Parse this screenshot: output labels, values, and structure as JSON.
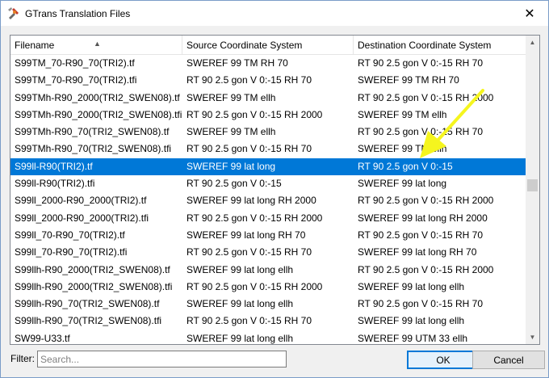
{
  "window": {
    "title": "GTrans Translation Files",
    "close_glyph": "✕"
  },
  "table": {
    "columns": [
      "Filename",
      "Source Coordinate System",
      "Destination Coordinate System"
    ],
    "sorted_column": "Filename",
    "selected_row": 7,
    "rows": [
      [
        "S99TM_70-R90_70(TRI2).tf",
        "SWEREF 99 TM RH 70",
        "RT 90 2.5 gon V 0:-15 RH 70"
      ],
      [
        "S99TM_70-R90_70(TRI2).tfi",
        "RT 90 2.5 gon V 0:-15 RH 70",
        "SWEREF 99 TM RH 70"
      ],
      [
        "S99TMh-R90_2000(TRI2_SWEN08).tf",
        "SWEREF 99 TM ellh",
        "RT 90 2.5 gon V 0:-15 RH 2000"
      ],
      [
        "S99TMh-R90_2000(TRI2_SWEN08).tfi",
        "RT 90 2.5 gon V 0:-15 RH 2000",
        "SWEREF 99 TM ellh"
      ],
      [
        "S99TMh-R90_70(TRI2_SWEN08).tf",
        "SWEREF 99 TM ellh",
        "RT 90 2.5 gon V 0:-15 RH 70"
      ],
      [
        "S99TMh-R90_70(TRI2_SWEN08).tfi",
        "RT 90 2.5 gon V 0:-15 RH 70",
        "SWEREF 99 TM ellh"
      ],
      [
        "S99ll-R90(TRI2).tf",
        "SWEREF 99 lat long",
        "RT 90 2.5 gon V 0:-15"
      ],
      [
        "S99ll-R90(TRI2).tfi",
        "RT 90 2.5 gon V 0:-15",
        "SWEREF 99 lat long"
      ],
      [
        "S99ll_2000-R90_2000(TRI2).tf",
        "SWEREF 99 lat long RH 2000",
        "RT 90 2.5 gon V 0:-15 RH 2000"
      ],
      [
        "S99ll_2000-R90_2000(TRI2).tfi",
        "RT 90 2.5 gon V 0:-15 RH 2000",
        "SWEREF 99 lat long RH 2000"
      ],
      [
        "S99ll_70-R90_70(TRI2).tf",
        "SWEREF 99 lat long RH 70",
        "RT 90 2.5 gon V 0:-15 RH 70"
      ],
      [
        "S99ll_70-R90_70(TRI2).tfi",
        "RT 90 2.5 gon V 0:-15 RH 70",
        "SWEREF 99 lat long RH 70"
      ],
      [
        "S99llh-R90_2000(TRI2_SWEN08).tf",
        "SWEREF 99 lat long ellh",
        "RT 90 2.5 gon V 0:-15 RH 2000"
      ],
      [
        "S99llh-R90_2000(TRI2_SWEN08).tfi",
        "RT 90 2.5 gon V 0:-15 RH 2000",
        "SWEREF 99 lat long ellh"
      ],
      [
        "S99llh-R90_70(TRI2_SWEN08).tf",
        "SWEREF 99 lat long ellh",
        "RT 90 2.5 gon V 0:-15 RH 70"
      ],
      [
        "S99llh-R90_70(TRI2_SWEN08).tfi",
        "RT 90 2.5 gon V 0:-15 RH 70",
        "SWEREF 99 lat long ellh"
      ],
      [
        "SW99-U33.tf",
        "SWEREF 99 lat long ellh",
        "SWEREF 99 UTM 33 ellh"
      ]
    ]
  },
  "filter": {
    "label": "Filter:",
    "placeholder": "Search...",
    "value": ""
  },
  "buttons": {
    "ok": "OK",
    "cancel": "Cancel"
  },
  "colors": {
    "selection": "#0078d7",
    "annotation_arrow": "#f5f51e"
  }
}
